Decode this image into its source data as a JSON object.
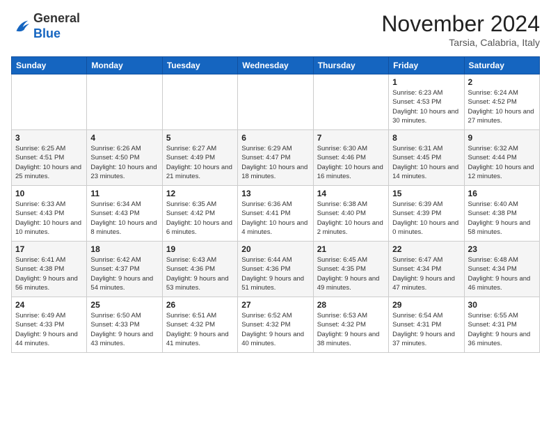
{
  "logo": {
    "general": "General",
    "blue": "Blue"
  },
  "title": "November 2024",
  "location": "Tarsia, Calabria, Italy",
  "weekdays": [
    "Sunday",
    "Monday",
    "Tuesday",
    "Wednesday",
    "Thursday",
    "Friday",
    "Saturday"
  ],
  "weeks": [
    [
      {
        "day": "",
        "info": ""
      },
      {
        "day": "",
        "info": ""
      },
      {
        "day": "",
        "info": ""
      },
      {
        "day": "",
        "info": ""
      },
      {
        "day": "",
        "info": ""
      },
      {
        "day": "1",
        "info": "Sunrise: 6:23 AM\nSunset: 4:53 PM\nDaylight: 10 hours and 30 minutes."
      },
      {
        "day": "2",
        "info": "Sunrise: 6:24 AM\nSunset: 4:52 PM\nDaylight: 10 hours and 27 minutes."
      }
    ],
    [
      {
        "day": "3",
        "info": "Sunrise: 6:25 AM\nSunset: 4:51 PM\nDaylight: 10 hours and 25 minutes."
      },
      {
        "day": "4",
        "info": "Sunrise: 6:26 AM\nSunset: 4:50 PM\nDaylight: 10 hours and 23 minutes."
      },
      {
        "day": "5",
        "info": "Sunrise: 6:27 AM\nSunset: 4:49 PM\nDaylight: 10 hours and 21 minutes."
      },
      {
        "day": "6",
        "info": "Sunrise: 6:29 AM\nSunset: 4:47 PM\nDaylight: 10 hours and 18 minutes."
      },
      {
        "day": "7",
        "info": "Sunrise: 6:30 AM\nSunset: 4:46 PM\nDaylight: 10 hours and 16 minutes."
      },
      {
        "day": "8",
        "info": "Sunrise: 6:31 AM\nSunset: 4:45 PM\nDaylight: 10 hours and 14 minutes."
      },
      {
        "day": "9",
        "info": "Sunrise: 6:32 AM\nSunset: 4:44 PM\nDaylight: 10 hours and 12 minutes."
      }
    ],
    [
      {
        "day": "10",
        "info": "Sunrise: 6:33 AM\nSunset: 4:43 PM\nDaylight: 10 hours and 10 minutes."
      },
      {
        "day": "11",
        "info": "Sunrise: 6:34 AM\nSunset: 4:43 PM\nDaylight: 10 hours and 8 minutes."
      },
      {
        "day": "12",
        "info": "Sunrise: 6:35 AM\nSunset: 4:42 PM\nDaylight: 10 hours and 6 minutes."
      },
      {
        "day": "13",
        "info": "Sunrise: 6:36 AM\nSunset: 4:41 PM\nDaylight: 10 hours and 4 minutes."
      },
      {
        "day": "14",
        "info": "Sunrise: 6:38 AM\nSunset: 4:40 PM\nDaylight: 10 hours and 2 minutes."
      },
      {
        "day": "15",
        "info": "Sunrise: 6:39 AM\nSunset: 4:39 PM\nDaylight: 10 hours and 0 minutes."
      },
      {
        "day": "16",
        "info": "Sunrise: 6:40 AM\nSunset: 4:38 PM\nDaylight: 9 hours and 58 minutes."
      }
    ],
    [
      {
        "day": "17",
        "info": "Sunrise: 6:41 AM\nSunset: 4:38 PM\nDaylight: 9 hours and 56 minutes."
      },
      {
        "day": "18",
        "info": "Sunrise: 6:42 AM\nSunset: 4:37 PM\nDaylight: 9 hours and 54 minutes."
      },
      {
        "day": "19",
        "info": "Sunrise: 6:43 AM\nSunset: 4:36 PM\nDaylight: 9 hours and 53 minutes."
      },
      {
        "day": "20",
        "info": "Sunrise: 6:44 AM\nSunset: 4:36 PM\nDaylight: 9 hours and 51 minutes."
      },
      {
        "day": "21",
        "info": "Sunrise: 6:45 AM\nSunset: 4:35 PM\nDaylight: 9 hours and 49 minutes."
      },
      {
        "day": "22",
        "info": "Sunrise: 6:47 AM\nSunset: 4:34 PM\nDaylight: 9 hours and 47 minutes."
      },
      {
        "day": "23",
        "info": "Sunrise: 6:48 AM\nSunset: 4:34 PM\nDaylight: 9 hours and 46 minutes."
      }
    ],
    [
      {
        "day": "24",
        "info": "Sunrise: 6:49 AM\nSunset: 4:33 PM\nDaylight: 9 hours and 44 minutes."
      },
      {
        "day": "25",
        "info": "Sunrise: 6:50 AM\nSunset: 4:33 PM\nDaylight: 9 hours and 43 minutes."
      },
      {
        "day": "26",
        "info": "Sunrise: 6:51 AM\nSunset: 4:32 PM\nDaylight: 9 hours and 41 minutes."
      },
      {
        "day": "27",
        "info": "Sunrise: 6:52 AM\nSunset: 4:32 PM\nDaylight: 9 hours and 40 minutes."
      },
      {
        "day": "28",
        "info": "Sunrise: 6:53 AM\nSunset: 4:32 PM\nDaylight: 9 hours and 38 minutes."
      },
      {
        "day": "29",
        "info": "Sunrise: 6:54 AM\nSunset: 4:31 PM\nDaylight: 9 hours and 37 minutes."
      },
      {
        "day": "30",
        "info": "Sunrise: 6:55 AM\nSunset: 4:31 PM\nDaylight: 9 hours and 36 minutes."
      }
    ]
  ]
}
